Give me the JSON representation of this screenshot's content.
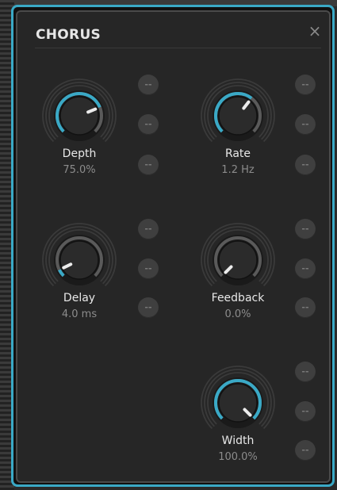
{
  "panel": {
    "title": "CHORUS",
    "close_glyph": "×",
    "accent": "#3aa9c6"
  },
  "knobs": [
    {
      "id": "depth",
      "label": "Depth",
      "value": "75.0%",
      "fraction": 0.75
    },
    {
      "id": "rate",
      "label": "Rate",
      "value": "1.2 Hz",
      "fraction": 0.64
    },
    {
      "id": "delay",
      "label": "Delay",
      "value": "4.0 ms",
      "fraction": 0.07
    },
    {
      "id": "feedback",
      "label": "Feedback",
      "value": "0.0%",
      "fraction": 0.0
    },
    {
      "id": "width",
      "label": "Width",
      "value": "100.0%",
      "fraction": 1.0
    }
  ],
  "mod_slot_label": "--"
}
